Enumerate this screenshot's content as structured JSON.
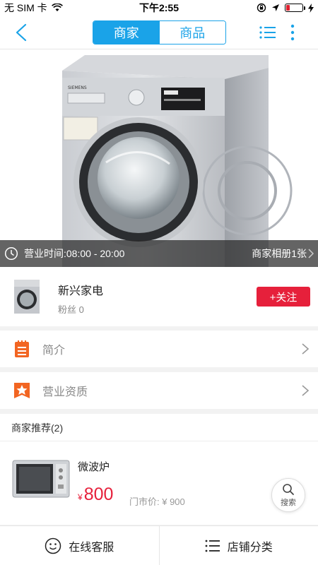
{
  "status_bar": {
    "carrier": "无 SIM 卡",
    "time": "下午2:55",
    "battery_fraction": 0.25
  },
  "nav": {
    "tabs": [
      {
        "label": "商家",
        "active": true
      },
      {
        "label": "商品",
        "active": false
      }
    ]
  },
  "hero": {
    "hours": "营业时间:08:00 - 20:00",
    "album": "商家相册1张"
  },
  "shop": {
    "name": "新兴家电",
    "fans": "粉丝 0",
    "follow_label": "+关注"
  },
  "menu": [
    {
      "label": "简介",
      "icon": "document-icon"
    },
    {
      "label": "营业资质",
      "icon": "star-badge-icon"
    }
  ],
  "recommend": {
    "title": "商家推荐(2)",
    "product": {
      "name": "微波炉",
      "currency": "¥",
      "price": "800",
      "market_price": "门市价: ¥ 900"
    }
  },
  "search_fab": {
    "label": "搜索"
  },
  "bottom_bar": {
    "service": "在线客服",
    "categories": "店铺分类"
  },
  "colors": {
    "accent": "#1aa3e8",
    "follow": "#e6203b",
    "menu_icon": "#f26522"
  }
}
